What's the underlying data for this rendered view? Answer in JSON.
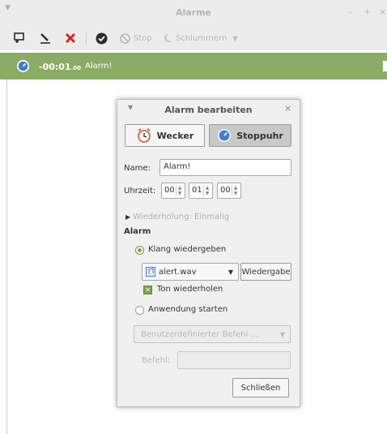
{
  "window": {
    "title": "Alarme",
    "controls": [
      "–",
      "+",
      "×"
    ]
  },
  "toolbar": {
    "stop_label": "Stop",
    "snooze_label": "Schlummern"
  },
  "alarm": {
    "time_main": "-00:01",
    "time_small": ".00",
    "name": "Alarm!",
    "row_color": "#8aac64"
  },
  "dialog": {
    "title": "Alarm bearbeiten",
    "mode_wecker": "Wecker",
    "mode_stoppuhr": "Stoppuhr",
    "name_label": "Name:",
    "name_value": "Alarm!",
    "time_label": "Uhrzeit:",
    "hours": "00",
    "minutes": "01",
    "seconds": "00",
    "repeat_text": "Wiederholung: Einmalig",
    "section_alarm": "Alarm",
    "radio_sound": "Klang wiedergeben",
    "sound_file": "alert.wav",
    "play_button": "Wiedergabe",
    "repeat_sound": "Ton wiederholen",
    "radio_app": "Anwendung starten",
    "custom_command_placeholder": "Benutzerdefinierter Befehl ...",
    "command_label": "Befehl:",
    "command_value": "",
    "close_button": "Schließen"
  },
  "colors": {
    "accent_green": "#7aa84f",
    "alarm_bar": "#8aac64",
    "clock_blue": "#3d7fd1"
  }
}
